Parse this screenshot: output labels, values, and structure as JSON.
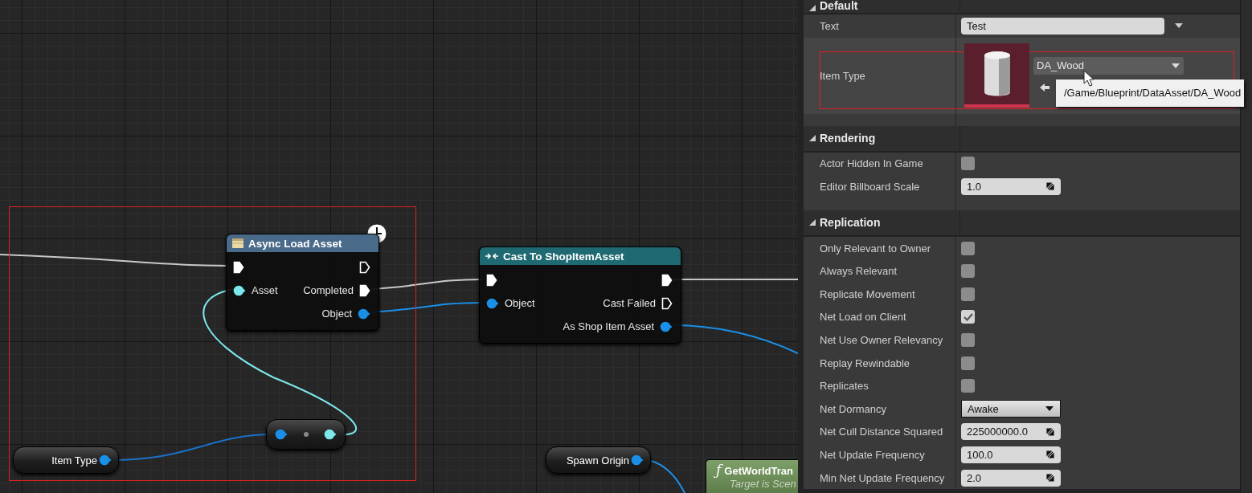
{
  "graph": {
    "nodes": [
      {
        "kind": "async",
        "title": "Async Load Asset",
        "color": "#4a6a8a",
        "latent": true,
        "rows": [
          {
            "left": {
              "kind": "exec",
              "connected": true
            },
            "right": {
              "kind": "exec",
              "connected": false
            }
          },
          {
            "left": {
              "kind": "data",
              "label": "Asset",
              "color": "#7de8ec",
              "connected": true
            },
            "right": {
              "kind": "exec",
              "label": "Completed",
              "connected": true
            }
          },
          {
            "right": {
              "kind": "data",
              "label": "Object",
              "color": "#1a8fe8",
              "connected": true
            }
          }
        ]
      },
      {
        "kind": "cast",
        "title": "Cast To ShopItemAsset",
        "color": "#1f6a72",
        "latent": false,
        "rows": [
          {
            "left": {
              "kind": "exec",
              "connected": true
            },
            "right": {
              "kind": "exec",
              "connected": true
            }
          },
          {
            "left": {
              "kind": "data",
              "label": "Object",
              "color": "#1a8fe8",
              "connected": true
            },
            "right": {
              "kind": "exec",
              "label": "Cast Failed",
              "connected": false
            }
          },
          {
            "right": {
              "kind": "data",
              "label": "As Shop Item Asset",
              "color": "#1a8fe8",
              "connected": true
            }
          }
        ]
      },
      {
        "kind": "conversion",
        "pins": [
          {
            "color": "#1a8fe8"
          },
          {
            "color": "#7de8ec"
          }
        ]
      },
      {
        "kind": "variable",
        "label": "Item Type",
        "color": "#1a8fe8"
      },
      {
        "kind": "variable",
        "label": "Spawn Origin",
        "color": "#1a8fe8"
      },
      {
        "kind": "pure_function",
        "icon": "ƒ",
        "title": "GetWorldTran",
        "subtitle": "Target is Scen"
      }
    ]
  },
  "details": {
    "sections": [
      {
        "title": "Default",
        "expanded": true,
        "rows": [
          {
            "kind": "text_field",
            "label": "Text",
            "value": "Test"
          },
          {
            "kind": "asset",
            "label": "Item Type",
            "value": "DA_Wood",
            "tooltip": "/Game/Blueprint/DataAsset/DA_Wood"
          }
        ]
      },
      {
        "title": "Rendering",
        "expanded": true,
        "rows": [
          {
            "kind": "checkbox",
            "label": "Actor Hidden In Game",
            "checked": false
          },
          {
            "kind": "number",
            "label": "Editor Billboard Scale",
            "value": "1.0"
          }
        ]
      },
      {
        "title": "Replication",
        "expanded": true,
        "rows": [
          {
            "kind": "checkbox",
            "label": "Only Relevant to Owner",
            "checked": false
          },
          {
            "kind": "checkbox",
            "label": "Always Relevant",
            "checked": false
          },
          {
            "kind": "checkbox",
            "label": "Replicate Movement",
            "checked": false
          },
          {
            "kind": "checkbox",
            "label": "Net Load on Client",
            "checked": true
          },
          {
            "kind": "checkbox",
            "label": "Net Use Owner Relevancy",
            "checked": false
          },
          {
            "kind": "checkbox",
            "label": "Replay Rewindable",
            "checked": false
          },
          {
            "kind": "checkbox",
            "label": "Replicates",
            "checked": false
          },
          {
            "kind": "dropdown",
            "label": "Net Dormancy",
            "value": "Awake"
          },
          {
            "kind": "number",
            "label": "Net Cull Distance Squared",
            "value": "225000000.0"
          },
          {
            "kind": "number",
            "label": "Net Update Frequency",
            "value": "100.0"
          },
          {
            "kind": "number",
            "label": "Min Net Update Frequency",
            "value": "2.0"
          }
        ]
      }
    ]
  }
}
